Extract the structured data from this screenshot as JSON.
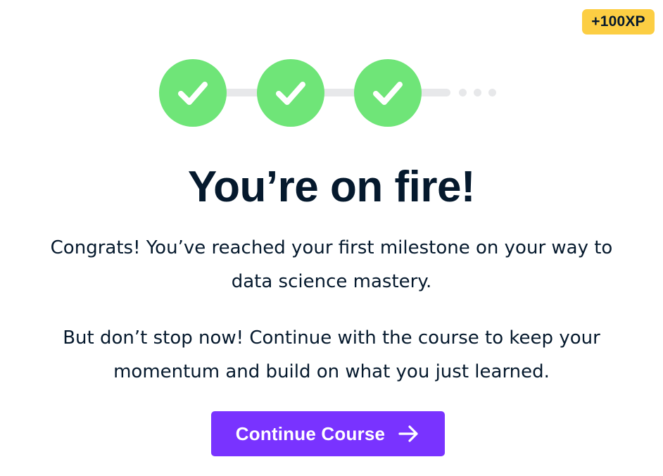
{
  "xp_badge": {
    "label": "+100XP",
    "color": "#fcce43"
  },
  "progress": {
    "completed_steps": 3,
    "total_steps": 4,
    "step_color": "#6fe578",
    "track_color": "#e7e8ea",
    "step_icon": "checkmark-icon"
  },
  "heading": {
    "title": "You’re on fire!"
  },
  "body": {
    "paragraph_1": "Congrats! You’ve reached your first milestone on your way to data science mastery.",
    "paragraph_2": "But don’t stop now! Continue with the course to keep your momentum and build on what you just learned."
  },
  "cta": {
    "label": "Continue Course",
    "icon": "arrow-right-icon",
    "color": "#7933ff"
  }
}
